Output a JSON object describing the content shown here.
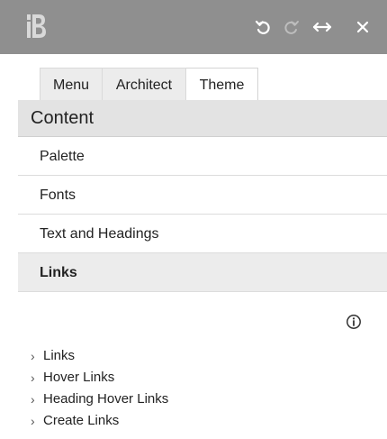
{
  "toolbar": {
    "logo_letter": "B",
    "icons": [
      "undo-icon",
      "redo-icon",
      "expand-horizontal-icon",
      "close-icon"
    ]
  },
  "tabs": [
    {
      "label": "Menu",
      "active": false
    },
    {
      "label": "Architect",
      "active": false
    },
    {
      "label": "Theme",
      "active": true
    }
  ],
  "section": {
    "title": "Content"
  },
  "menu": {
    "items": [
      {
        "label": "Palette",
        "active": false
      },
      {
        "label": "Fonts",
        "active": false
      },
      {
        "label": "Text and Headings",
        "active": false
      },
      {
        "label": "Links",
        "active": true
      }
    ]
  },
  "info_icon": "info-icon",
  "links": {
    "items": [
      {
        "label": "Links"
      },
      {
        "label": "Hover Links"
      },
      {
        "label": "Heading Hover Links"
      },
      {
        "label": "Create Links"
      }
    ]
  },
  "colors": {
    "toolbar_bg": "#8f8f8f",
    "section_bg": "#e3e3e3",
    "active_item_bg": "#ececec"
  }
}
